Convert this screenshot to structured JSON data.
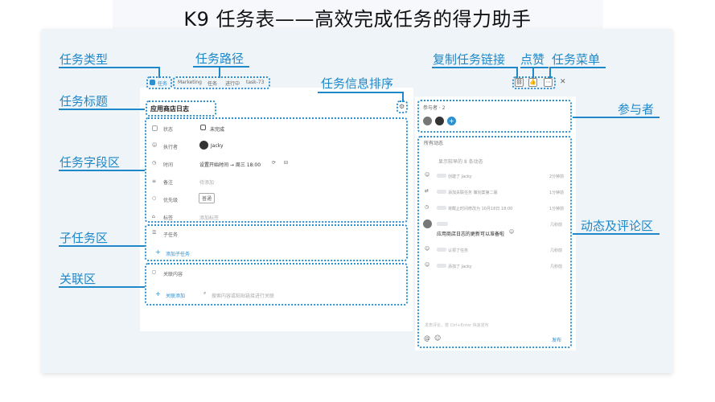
{
  "page_title": "K9 任务表——高效完成任务的得力助手",
  "annotations": {
    "task_type": "任务类型",
    "task_path": "任务路径",
    "task_title": "任务标题",
    "task_fields": "任务字段区",
    "subtask_area": "子任务区",
    "relation_area": "关联区",
    "info_sort": "任务信息排序",
    "copy_link": "复制任务链接",
    "like": "点赞",
    "task_menu": "任务菜单",
    "participants": "参与者",
    "activity_area": "动态及评论区"
  },
  "breadcrumb": {
    "type": "任务",
    "items": [
      "Marketing",
      "任务",
      "进行中",
      "task-73"
    ]
  },
  "task": {
    "title": "应用商店日志",
    "fields": [
      {
        "label": "状态",
        "value": "未完成"
      },
      {
        "label": "执行者",
        "value": "Jacky"
      },
      {
        "label": "时间",
        "value": "设置开始时间 → 周三 18:00"
      },
      {
        "label": "备注",
        "value": "待添加"
      },
      {
        "label": "优先级",
        "value": "普通"
      },
      {
        "label": "标签",
        "value": "添加标签"
      }
    ]
  },
  "subtasks": {
    "header": "子任务",
    "add": "添加子任务"
  },
  "relations": {
    "header": "关联内容",
    "add": "关联添加",
    "search_placeholder": "搜索内容或粘贴链接进行关联"
  },
  "participants": {
    "label": "参与者 · 2"
  },
  "activity": {
    "filter": "所有动态",
    "collapsed": "显示较早的 8 条动态",
    "items": [
      {
        "text": "创建了 Jacky",
        "time": "2分钟前"
      },
      {
        "text": "添加关联任务 策划案第二版",
        "time": "1分钟前"
      },
      {
        "text": "将截止时间修改为 10月18日 18:00",
        "time": "1分钟前"
      },
      {
        "text": "应用商店日志的更新可以准备啦",
        "time": "几秒前"
      },
      {
        "text": "认领了任务",
        "time": "几秒前"
      },
      {
        "text": "添加了 Jacky",
        "time": "几秒前"
      }
    ],
    "comment_placeholder": "发表评论，按 Ctrl+Enter 快速发布",
    "send": "发布"
  }
}
